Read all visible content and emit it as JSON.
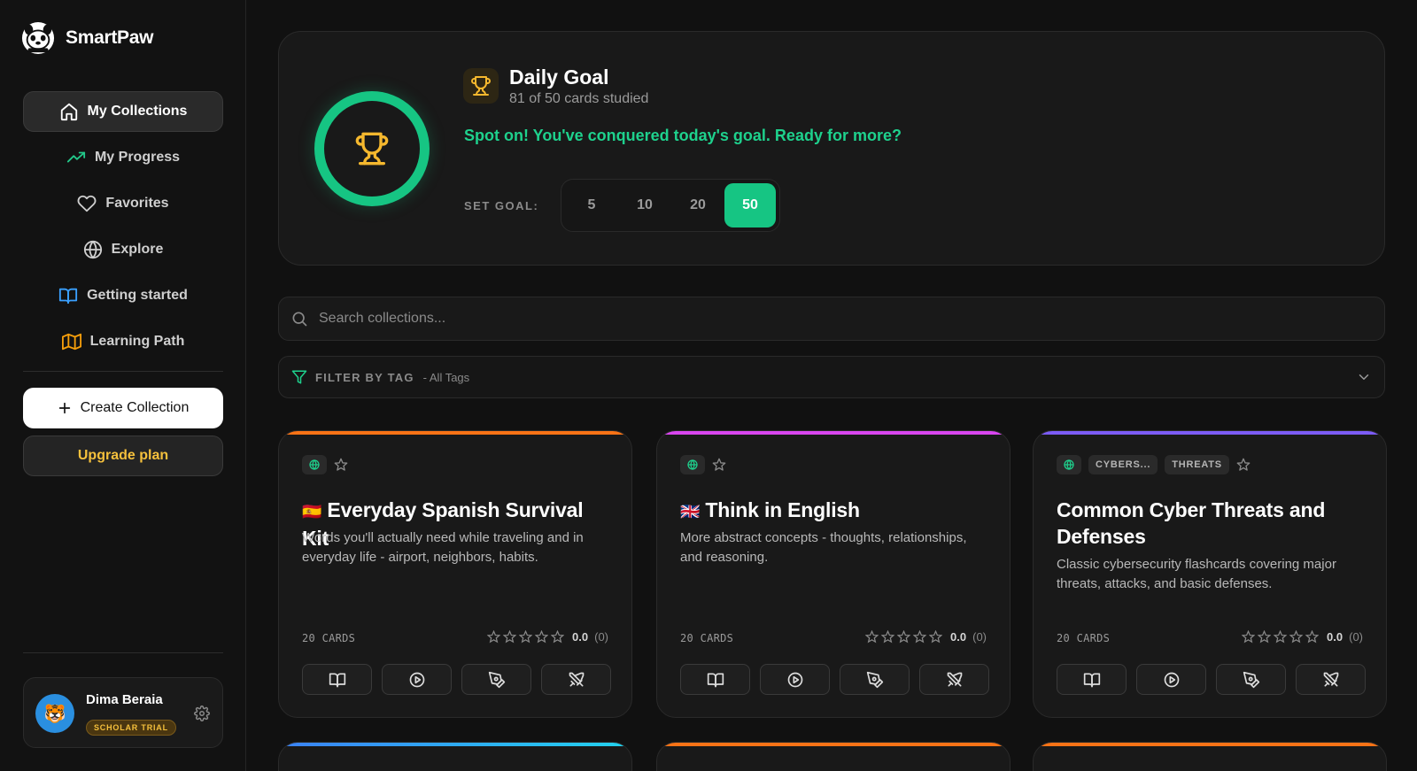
{
  "brand": {
    "name": "SmartPaw"
  },
  "sidebar": {
    "items": [
      {
        "label": "My Collections",
        "icon": "home-icon",
        "active": true,
        "color": "#ffffff"
      },
      {
        "label": "My Progress",
        "icon": "trending-up-icon",
        "color": "#22c98a"
      },
      {
        "label": "Favorites",
        "icon": "heart-icon",
        "color": "#cfcfcf"
      },
      {
        "label": "Explore",
        "icon": "globe-icon",
        "color": "#cfcfcf"
      },
      {
        "label": "Getting started",
        "icon": "book-open-icon",
        "color": "#3aa0ff"
      },
      {
        "label": "Learning Path",
        "icon": "map-icon",
        "color": "#f59e0b"
      }
    ],
    "create_label": "Create Collection",
    "upgrade_label": "Upgrade plan"
  },
  "user": {
    "name": "Dima Beraia",
    "badge": "SCHOLAR TRIAL",
    "avatar_emoji": "🐯"
  },
  "goal": {
    "title": "Daily Goal",
    "subtitle": "81 of 50 cards studied",
    "message": "Spot on! You've conquered today's goal. Ready for more?",
    "set_label": "SET GOAL:",
    "options": [
      "5",
      "10",
      "20",
      "50"
    ],
    "selected": "50",
    "progress_fraction": 1.0,
    "accent": "#16c583"
  },
  "search": {
    "placeholder": "Search collections..."
  },
  "filter": {
    "label": "FILTER BY TAG",
    "value": "- All Tags"
  },
  "cards": [
    {
      "flag": "🇪🇸",
      "title": "Everyday Spanish Survival Kit",
      "description": "Words you'll actually need while traveling and in everyday life - airport, neighbors, habits.",
      "tags": [],
      "count": "20 CARDS",
      "rating": "0.0",
      "rating_count": "(0)",
      "accent": "#f97316"
    },
    {
      "flag": "🇬🇧",
      "title": "Think in English",
      "description": "More abstract concepts - thoughts, relationships, and reasoning.",
      "tags": [],
      "count": "20 CARDS",
      "rating": "0.0",
      "rating_count": "(0)",
      "accent": "#d946ef"
    },
    {
      "flag": "",
      "title": "Common Cyber Threats and Defenses",
      "description": "Classic cybersecurity flashcards covering major threats, attacks, and basic defenses.",
      "tags": [
        "CYBERS...",
        "THREATS"
      ],
      "count": "20 CARDS",
      "rating": "0.0",
      "rating_count": "(0)",
      "accent": "#7c5cf6"
    }
  ],
  "peek_accents": [
    "#3b82f6",
    "#f97316",
    "#f97316"
  ]
}
